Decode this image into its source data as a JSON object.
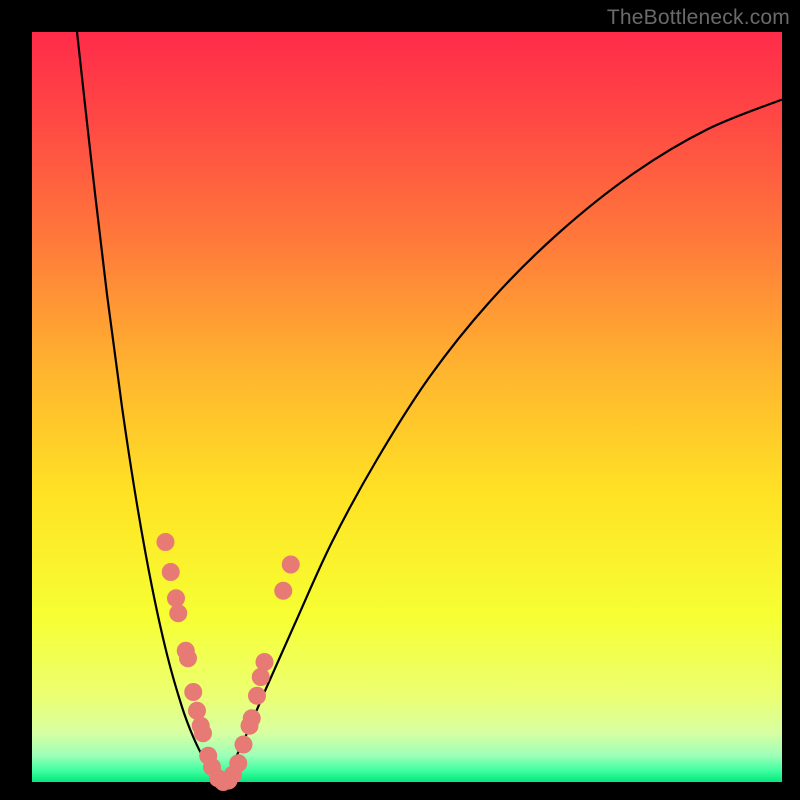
{
  "watermark": {
    "text": "TheBottleneck.com"
  },
  "colors": {
    "background": "#000000",
    "curve": "#000000",
    "marker_fill": "#e77a74",
    "marker_stroke": "#c95b57",
    "gradient_stops": [
      {
        "offset": 0.0,
        "color": "#ff2b4a"
      },
      {
        "offset": 0.12,
        "color": "#ff4944"
      },
      {
        "offset": 0.28,
        "color": "#ff7a3a"
      },
      {
        "offset": 0.45,
        "color": "#ffb42f"
      },
      {
        "offset": 0.62,
        "color": "#ffe324"
      },
      {
        "offset": 0.78,
        "color": "#f6ff33"
      },
      {
        "offset": 0.885,
        "color": "#ecff72"
      },
      {
        "offset": 0.935,
        "color": "#d7ffa2"
      },
      {
        "offset": 0.965,
        "color": "#9cffb8"
      },
      {
        "offset": 0.985,
        "color": "#3effa0"
      },
      {
        "offset": 1.0,
        "color": "#06e77a"
      }
    ]
  },
  "chart_data": {
    "type": "line",
    "title": "",
    "xlabel": "",
    "ylabel": "",
    "xlim": [
      0,
      1
    ],
    "ylim": [
      0,
      1
    ],
    "series": [
      {
        "name": "left-curve",
        "x": [
          0.06,
          0.08,
          0.1,
          0.12,
          0.14,
          0.16,
          0.18,
          0.2,
          0.215,
          0.23,
          0.245,
          0.255
        ],
        "values": [
          1.0,
          0.82,
          0.65,
          0.5,
          0.37,
          0.26,
          0.17,
          0.1,
          0.06,
          0.03,
          0.01,
          0.0
        ]
      },
      {
        "name": "right-curve",
        "x": [
          0.255,
          0.28,
          0.31,
          0.35,
          0.4,
          0.46,
          0.53,
          0.61,
          0.7,
          0.8,
          0.9,
          1.0
        ],
        "values": [
          0.0,
          0.05,
          0.12,
          0.21,
          0.32,
          0.43,
          0.54,
          0.64,
          0.73,
          0.81,
          0.87,
          0.91
        ]
      }
    ],
    "markers": [
      {
        "series": "left-curve",
        "x": 0.178,
        "y": 0.32
      },
      {
        "series": "left-curve",
        "x": 0.185,
        "y": 0.28
      },
      {
        "series": "left-curve",
        "x": 0.192,
        "y": 0.245
      },
      {
        "series": "left-curve",
        "x": 0.195,
        "y": 0.225
      },
      {
        "series": "left-curve",
        "x": 0.205,
        "y": 0.175
      },
      {
        "series": "left-curve",
        "x": 0.208,
        "y": 0.165
      },
      {
        "series": "left-curve",
        "x": 0.215,
        "y": 0.12
      },
      {
        "series": "left-curve",
        "x": 0.22,
        "y": 0.095
      },
      {
        "series": "left-curve",
        "x": 0.225,
        "y": 0.075
      },
      {
        "series": "left-curve",
        "x": 0.228,
        "y": 0.065
      },
      {
        "series": "left-curve",
        "x": 0.235,
        "y": 0.035
      },
      {
        "series": "left-curve",
        "x": 0.24,
        "y": 0.02
      },
      {
        "series": "left-curve",
        "x": 0.248,
        "y": 0.005
      },
      {
        "series": "left-curve",
        "x": 0.255,
        "y": 0.0
      },
      {
        "series": "right-curve",
        "x": 0.262,
        "y": 0.002
      },
      {
        "series": "right-curve",
        "x": 0.268,
        "y": 0.01
      },
      {
        "series": "right-curve",
        "x": 0.275,
        "y": 0.025
      },
      {
        "series": "right-curve",
        "x": 0.282,
        "y": 0.05
      },
      {
        "series": "right-curve",
        "x": 0.29,
        "y": 0.075
      },
      {
        "series": "right-curve",
        "x": 0.293,
        "y": 0.085
      },
      {
        "series": "right-curve",
        "x": 0.3,
        "y": 0.115
      },
      {
        "series": "right-curve",
        "x": 0.305,
        "y": 0.14
      },
      {
        "series": "right-curve",
        "x": 0.31,
        "y": 0.16
      },
      {
        "series": "right-curve",
        "x": 0.335,
        "y": 0.255
      },
      {
        "series": "right-curve",
        "x": 0.345,
        "y": 0.29
      }
    ],
    "marker_size_frac": 0.012
  }
}
